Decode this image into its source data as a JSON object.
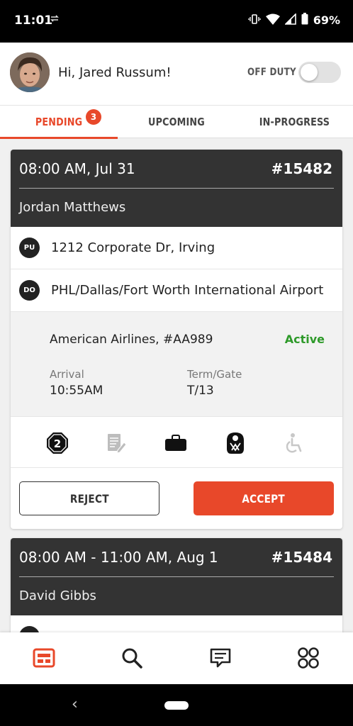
{
  "status_bar": {
    "time": "11:01",
    "battery": "69%",
    "icons": [
      "vibrate-icon",
      "wifi-icon",
      "signal-icon",
      "battery-icon"
    ]
  },
  "header": {
    "greeting": "Hi, Jared Russum!",
    "duty_label": "OFF DUTY",
    "duty_on": false
  },
  "tabs": [
    {
      "label": "PENDING",
      "badge": "3",
      "active": true
    },
    {
      "label": "UPCOMING",
      "active": false
    },
    {
      "label": "IN-PROGRESS",
      "active": false
    }
  ],
  "cards": [
    {
      "when": "08:00 AM, Jul 31",
      "number": "#15482",
      "passenger": "Jordan Matthews",
      "pickup_tag": "PU",
      "pickup": "1212 Corporate Dr, Irving",
      "dropoff_tag": "DO",
      "dropoff": "PHL/Dallas/Fort Worth International Airport",
      "flight": {
        "airline": "American Airlines, #AA989",
        "status": "Active",
        "arrival_label": "Arrival",
        "arrival": "10:55AM",
        "gate_label": "Term/Gate",
        "gate": "T/13"
      },
      "passenger_count": "2",
      "feature_icons": [
        "passengers-icon",
        "notes-icon",
        "luggage-icon",
        "child-seat-icon",
        "wheelchair-icon"
      ],
      "reject_label": "REJECT",
      "accept_label": "ACCEPT"
    },
    {
      "when": "08:00 AM - 11:00 AM, Aug 1",
      "number": "#15484",
      "passenger": "David Gibbs"
    }
  ],
  "bottom_nav": [
    "dashboard-icon",
    "search-icon",
    "messages-icon",
    "more-icon"
  ],
  "colors": {
    "accent": "#e8482a",
    "active_status": "#2e9a2a",
    "card_header": "#333333"
  }
}
